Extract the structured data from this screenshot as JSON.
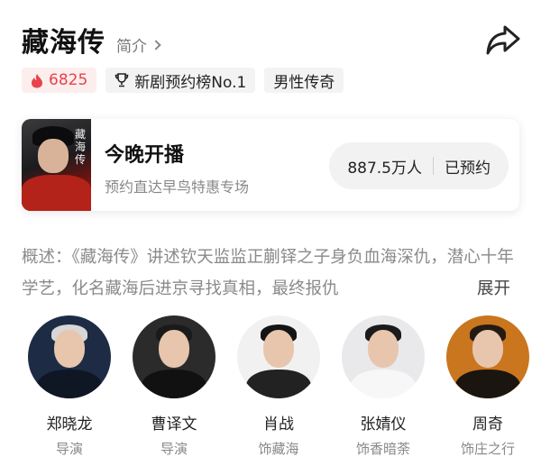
{
  "header": {
    "title": "藏海传",
    "intro_label": "简介"
  },
  "tags": [
    {
      "label": "6825",
      "icon": "flame-icon",
      "color": "#e8434a"
    },
    {
      "label": "新剧预约榜No.1",
      "icon": "trophy-icon"
    },
    {
      "label": "男性传奇"
    }
  ],
  "card": {
    "poster_text": "藏海传",
    "title": "今晚开播",
    "subtitle": "预约直达早鸟特惠专场",
    "count": "887.5万人",
    "status": "已预约"
  },
  "summary": {
    "text": "概述：《藏海传》讲述钦天监监正蒯铎之子身负血海深仇，潜心十年学艺，化名藏海后进京寻找真相，最终报仇",
    "expand_label": "展开"
  },
  "cast": [
    {
      "name": "郑晓龙",
      "role": "导演"
    },
    {
      "name": "曹译文",
      "role": "导演"
    },
    {
      "name": "肖战",
      "role": "饰藏海"
    },
    {
      "name": "张婧仪",
      "role": "饰香暗荼"
    },
    {
      "name": "周奇",
      "role": "饰庄之行"
    }
  ],
  "colors": {
    "accent_red": "#e8434a",
    "text_gray": "#8a8a8a"
  }
}
